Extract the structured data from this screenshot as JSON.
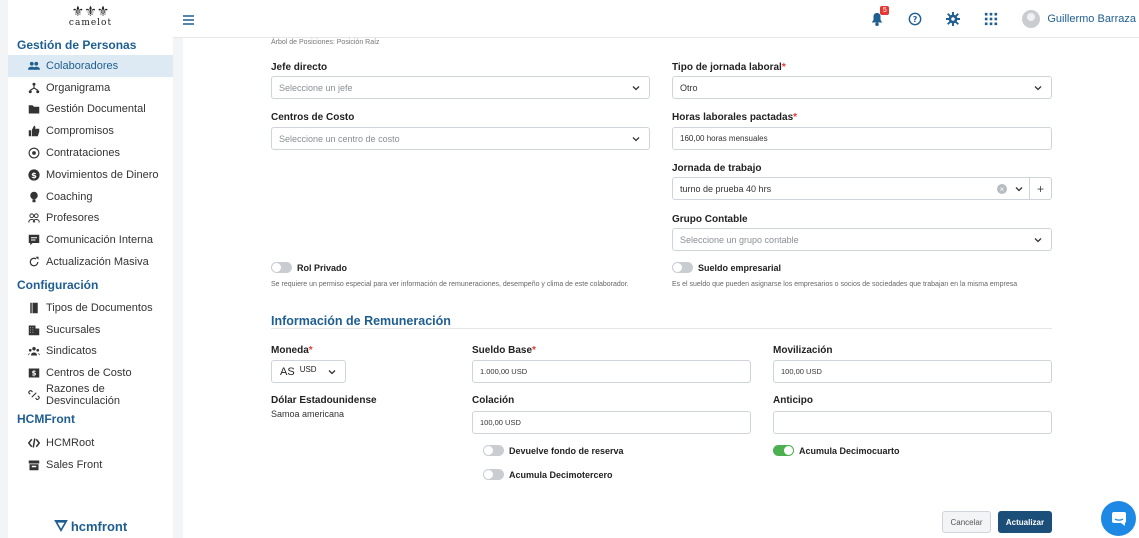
{
  "logo": {
    "crest": "⚜⚜⚜",
    "text": "camelot"
  },
  "sidebar": {
    "sections": [
      {
        "title": "Gestión de Personas",
        "items": [
          {
            "label": "Colaboradores",
            "icon": "users-icon",
            "active": true
          },
          {
            "label": "Organigrama",
            "icon": "org-chart-icon"
          },
          {
            "label": "Gestión Documental",
            "icon": "folder-icon"
          },
          {
            "label": "Compromisos",
            "icon": "thumbs-up-icon"
          },
          {
            "label": "Contrataciones",
            "icon": "target-icon"
          },
          {
            "label": "Movimientos de Dinero",
            "icon": "dollar-icon"
          },
          {
            "label": "Coaching",
            "icon": "lightbulb-icon"
          },
          {
            "label": "Profesores",
            "icon": "teachers-icon"
          },
          {
            "label": "Comunicación Interna",
            "icon": "message-icon"
          },
          {
            "label": "Actualización Masiva",
            "icon": "refresh-icon"
          }
        ]
      },
      {
        "title": "Configuración",
        "items": [
          {
            "label": "Tipos de Documentos",
            "icon": "book-icon"
          },
          {
            "label": "Sucursales",
            "icon": "building-icon"
          },
          {
            "label": "Sindicatos",
            "icon": "group-icon"
          },
          {
            "label": "Centros de Costo",
            "icon": "money-icon"
          },
          {
            "label": "Razones de Desvinculación",
            "icon": "unlink-icon"
          }
        ]
      },
      {
        "title": "HCMFront",
        "items": [
          {
            "label": "HCMRoot",
            "icon": "code-icon"
          },
          {
            "label": "Sales Front",
            "icon": "store-icon"
          }
        ]
      }
    ],
    "footer_logo": "hcmfront"
  },
  "topbar": {
    "notification_count": "5",
    "username": "Guillermo Barraza"
  },
  "form": {
    "breadcrumb": "Árbol de Posiciones: Posición Raíz",
    "jefe_directo": {
      "label": "Jefe directo",
      "placeholder": "Seleccione un jefe"
    },
    "centros_costo": {
      "label": "Centros de Costo",
      "placeholder": "Seleccione un centro de costo"
    },
    "tipo_jornada": {
      "label": "Tipo de jornada laboral",
      "required": "*",
      "value": "Otro"
    },
    "horas_pactadas": {
      "label": "Horas laborales pactadas",
      "required": "*",
      "value": "160,00 horas mensuales"
    },
    "jornada_trabajo": {
      "label": "Jornada de trabajo",
      "value": "turno de prueba 40 hrs"
    },
    "grupo_contable": {
      "label": "Grupo Contable",
      "placeholder": "Seleccione un grupo contable"
    },
    "rol_privado": {
      "label": "Rol Privado",
      "help": "Se requiere un permiso especial para ver información de remuneraciones, desempeño y clima de este colaborador.",
      "on": false
    },
    "sueldo_empresarial": {
      "label": "Sueldo empresarial",
      "help": "Es el sueldo que pueden asignarse los empresarios o socios de sociedades que trabajan en la misma empresa",
      "on": false
    }
  },
  "remuneracion": {
    "heading": "Información de Remuneración",
    "moneda": {
      "label": "Moneda",
      "required": "*",
      "prefix": "AS",
      "code": "USD"
    },
    "moneda_nombre": "Dólar Estadounidense",
    "moneda_pais": "Samoa americana",
    "sueldo_base": {
      "label": "Sueldo Base",
      "required": "*",
      "value": "1.000,00 USD"
    },
    "movilizacion": {
      "label": "Movilización",
      "value": "100,00 USD"
    },
    "colacion": {
      "label": "Colación",
      "value": "100,00 USD"
    },
    "anticipo": {
      "label": "Anticipo",
      "value": ""
    },
    "devuelve_fondo": {
      "label": "Devuelve fondo de reserva",
      "on": false
    },
    "acumula_decimotercero": {
      "label": "Acumula Decimotercero",
      "on": false
    },
    "acumula_decimocuarto": {
      "label": "Acumula Decimocuarto",
      "on": true
    }
  },
  "actions": {
    "cancel": "Cancelar",
    "update": "Actualizar"
  },
  "colors": {
    "primary": "#1e5e91",
    "accent": "#1e88e5",
    "success": "#4caf50",
    "danger": "#e53935"
  }
}
